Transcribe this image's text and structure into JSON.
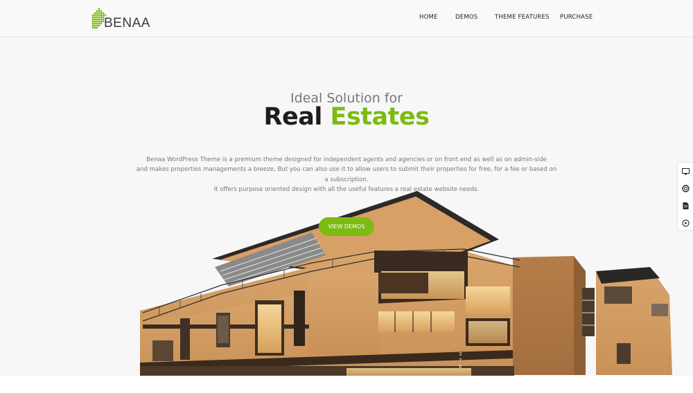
{
  "brand": {
    "name": "BENAA",
    "accent_color": "#7dbb12",
    "logo_icon": "house-dots-icon"
  },
  "nav": {
    "items": [
      "HOME",
      "DEMOS",
      "THEME FEATURES",
      "PURCHASE"
    ]
  },
  "hero": {
    "subtitle": "Ideal Solution for",
    "title_main": "Real",
    "title_accent": "Estates",
    "description_lines": [
      "Benaa WordPress Theme is a premium theme designed for independent agents and agencies or on front end as well as on admin-side",
      "and makes properties managements a breeze, But you can also use it to allow users to submit their properties for free, for a fee or based on",
      "a subscription.",
      "It offers purpose oriented design with all the useful features a real estate website needs."
    ],
    "cta_label": "VIEW DEMOS"
  },
  "building": {
    "house_number": "376"
  },
  "side_toolbar": {
    "icons": [
      "monitor-icon",
      "lifebuoy-icon",
      "document-icon",
      "play-icon"
    ]
  }
}
